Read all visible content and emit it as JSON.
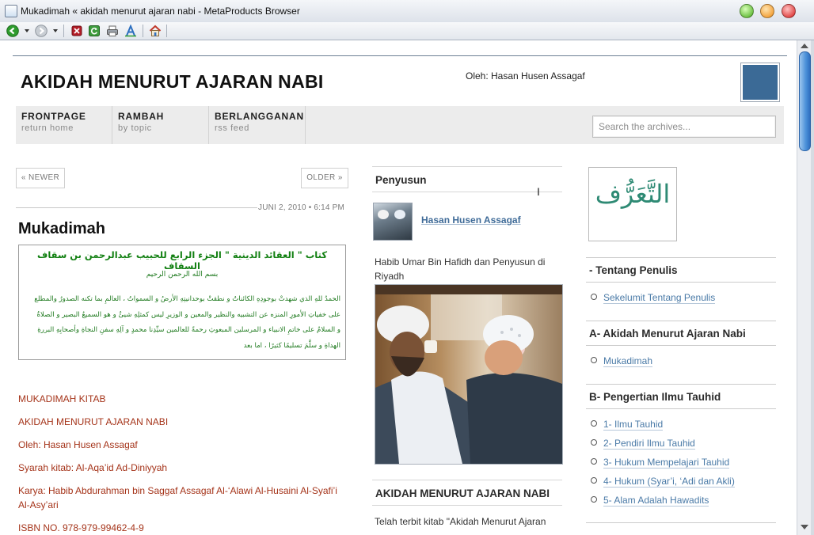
{
  "window": {
    "title": "Mukadimah « akidah menurut ajaran nabi - MetaProducts Browser"
  },
  "toolbar": {
    "icons": [
      "back-icon",
      "forward-icon",
      "stop-icon",
      "refresh-icon",
      "print-icon",
      "font-icon",
      "home-icon"
    ]
  },
  "site": {
    "title": "AKIDAH MENURUT AJARAN NABI",
    "byline": "Oleh: Hasan Husen Assagaf",
    "header_color": "#3b6a96"
  },
  "nav": [
    {
      "label": "FRONTPAGE",
      "sub": "return home"
    },
    {
      "label": "RAMBAH",
      "sub": "by topic"
    },
    {
      "label": "BERLANGGANAN",
      "sub": "rss feed"
    }
  ],
  "search": {
    "placeholder": "Search the archives..."
  },
  "post": {
    "newer": "« NEWER",
    "older": "OLDER »",
    "date": "JUNI 2, 2010 • 6:14 PM",
    "title": "Mukadimah",
    "arabic_title": "كتاب \" العقائد الدينية \" الجزء الرابع للحبيب عبدالرحمن بن سقاف السقاف",
    "arabic_basmala": "بسم الله الرحمن الرحيم",
    "arabic_line1": "الحمدُ للهِ الذي شهدتْ بوجودِهِ الكائناتُ و نطقتْ بوحدانيتِهِ الأرضُ و السمواتُ ، العالمِ بما تكنه الصدورُ والمطلع",
    "arabic_line2": "على خفياتِ الأمورِ المنزه عن التشبيه والنظير والمعين و الوزيرِ ليس كمثلِهِ شيئٌ و هو السميعُ البصير و الصلاةُ",
    "arabic_line3": "و السلامُ على خاتمِ الانبياء و المرسلين المبعوثِ رحمةً للعالمين سيِّدِنا محمدٍ و آلِهِ سفنِ النجاةِ وأصحابِهِ البررةِ",
    "arabic_line4": "الهداةِ و سلَّمَ تسليمًا كثيرًا ، اما بعد",
    "body": [
      "MUKADIMAH KITAB",
      "AKIDAH MENURUT AJARAN NABI",
      "Oleh: Hasan Husen Assagaf",
      "Syarah kitab: Al-Aqa’id Ad-Diniyyah",
      "Karya: Habib Abdurahman bin Saggaf Assagaf Al-‘Alawi Al-Husaini Al-Syafi’i Al-Asy’ari",
      "ISBN NO. 978-979-99462-4-9"
    ],
    "body_color": "#a5341a"
  },
  "sidebar_mid": {
    "heading": "Penyusun",
    "author": "Hasan Husen Assagaf",
    "caption": "Habib Umar Bin Hafidh dan Penyusun di Riyadh",
    "heading2": "AKIDAH MENURUT AJARAN NABI",
    "para": "Telah terbit kitab \"Akidah Menurut Ajaran"
  },
  "sidebar_right": {
    "logo_text": "التَّعَرُّف",
    "widgets": [
      {
        "heading": "- Tentang Penulis",
        "items": [
          "Sekelumit Tentang Penulis"
        ]
      },
      {
        "heading": "A- Akidah Menurut Ajaran Nabi",
        "items": [
          "Mukadimah"
        ]
      },
      {
        "heading": "B- Pengertian Ilmu Tauhid",
        "items": [
          "1- Ilmu Tauhid",
          "2- Pendiri Ilmu Tauhid",
          "3- Hukum Mempelajari Tauhid",
          "4- Hukum (Syar’i, ‘Adi dan Akli)",
          "5- Alam Adalah Hawadits"
        ]
      }
    ]
  }
}
